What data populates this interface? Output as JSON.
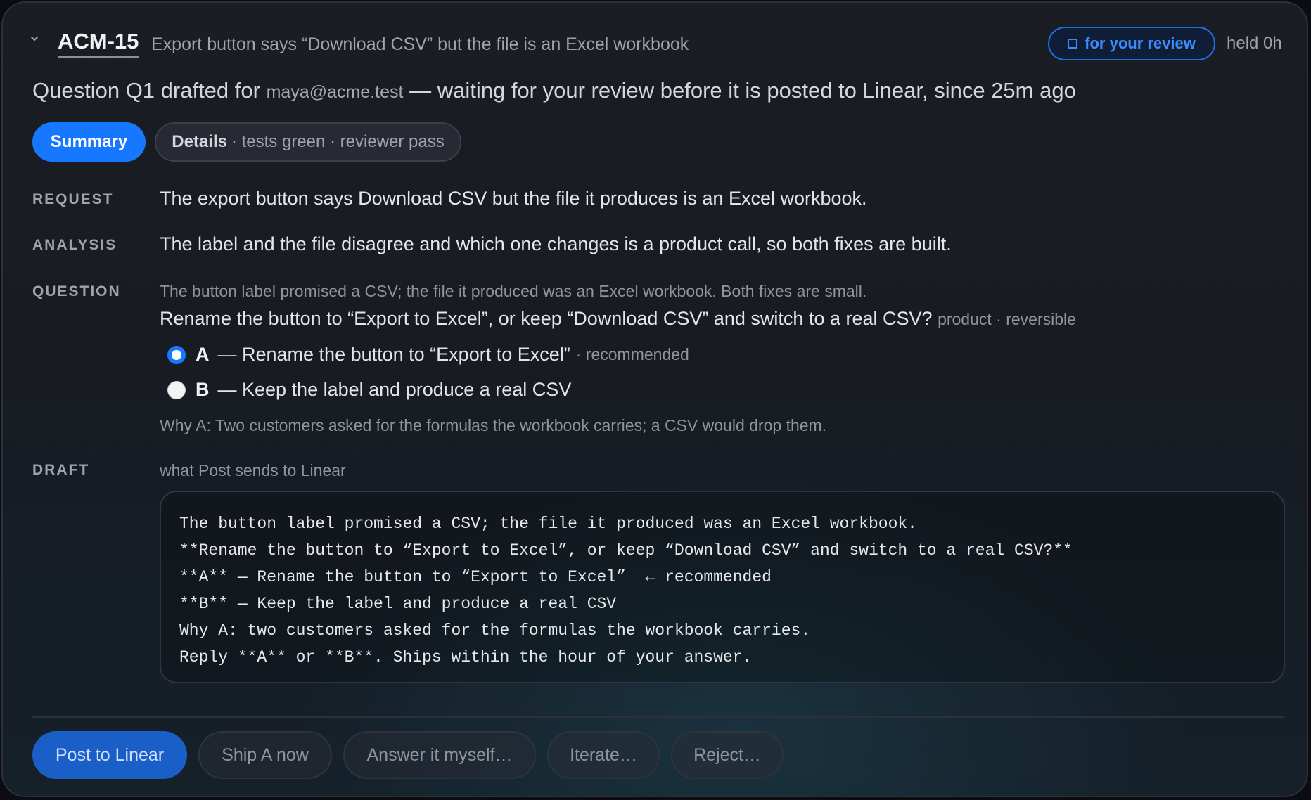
{
  "header": {
    "ticket_id": "ACM-15",
    "ticket_title": "Export button says “Download CSV” but the file is an Excel workbook",
    "review_badge": "for your review",
    "held": "held 0h"
  },
  "status": {
    "prefix": "Question Q1 drafted for",
    "email": "maya@acme.test",
    "suffix": "— waiting for your review before it is posted to Linear, since 25m ago"
  },
  "tabs": {
    "summary": "Summary",
    "details_label": "Details",
    "details_meta": "· tests green · reviewer pass"
  },
  "request": {
    "label": "REQUEST",
    "text": "The export button says Download CSV but the file it produces is an Excel workbook."
  },
  "analysis": {
    "label": "ANALYSIS",
    "text": "The label and the file disagree and which one changes is a product call, so both fixes are built."
  },
  "question": {
    "label": "QUESTION",
    "context": "The button label promised a CSV; the file it produced was an Excel workbook. Both fixes are small.",
    "prompt": "Rename the button to “Export to Excel”, or keep “Download CSV” and switch to a real CSV?",
    "tags": "product · reversible",
    "options": [
      {
        "letter": "A",
        "text": "— Rename the button to “Export to Excel”",
        "note": "· recommended",
        "selected": true
      },
      {
        "letter": "B",
        "text": "— Keep the label and produce a real CSV",
        "note": "",
        "selected": false
      }
    ],
    "why": "Why A: Two customers asked for the formulas the workbook carries; a CSV would drop them."
  },
  "draft": {
    "label": "DRAFT",
    "caption": "what Post sends to Linear",
    "lines": [
      "The button label promised a CSV; the file it produced was an Excel workbook.",
      "**Rename the button to “Export to Excel”, or keep “Download CSV” and switch to a real CSV?**",
      "**A** — Rename the button to “Export to Excel”  ← recommended",
      "**B** — Keep the label and produce a real CSV",
      "Why A: two customers asked for the formulas the workbook carries.",
      "Reply **A** or **B**. Ships within the hour of your answer."
    ]
  },
  "actions": {
    "post": "Post to Linear",
    "ship": "Ship A now",
    "answer": "Answer it myself…",
    "iterate": "Iterate…",
    "reject": "Reject…"
  },
  "colors": {
    "accent": "#1677ff",
    "background": "#1b1d24"
  }
}
